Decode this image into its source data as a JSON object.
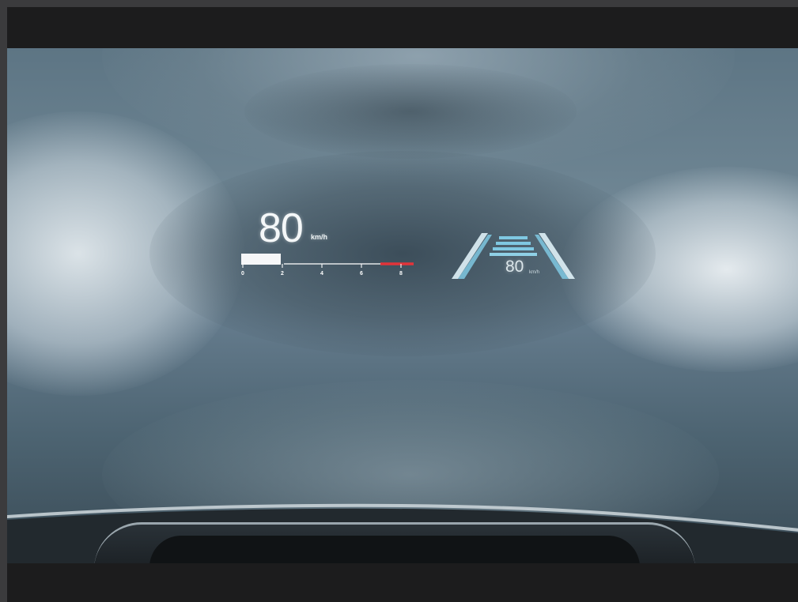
{
  "hud": {
    "speed": "80",
    "speed_unit": "km/h",
    "gauge_ticks": [
      "0",
      "2",
      "4",
      "6",
      "8"
    ],
    "gauge_fill_fraction": 0.25,
    "lane_assist_speed": "80",
    "lane_assist_unit": "km/h",
    "colors": {
      "speed_text": "#f4f7f8",
      "gauge_fill": "#ffffff",
      "redline": "#e2343a",
      "lane_stripes": "#7fc8e2",
      "lane_marker": "#dff1f7"
    }
  },
  "scene": {
    "subject": "windshield head-up display over blurred city street",
    "icons": [
      "speed-gauge-icon",
      "lane-assist-icon"
    ]
  }
}
